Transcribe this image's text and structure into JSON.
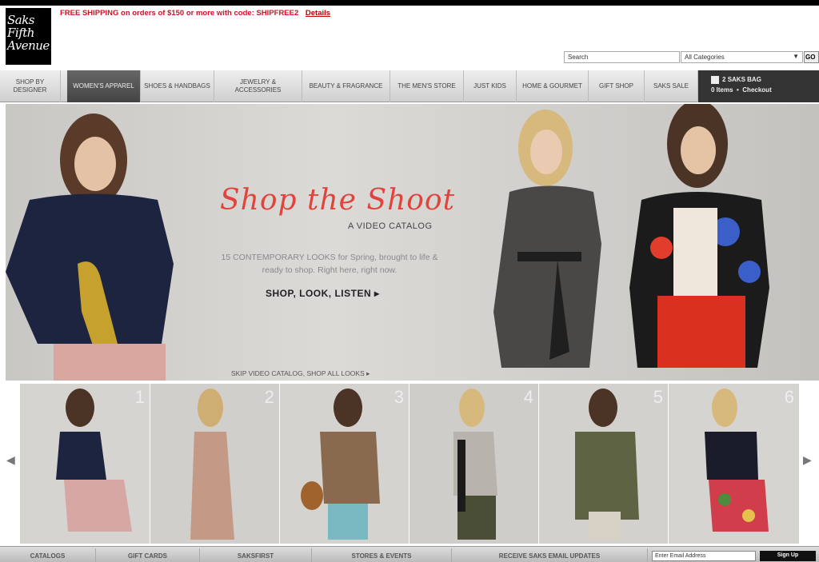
{
  "logo": {
    "line1": "Saks",
    "line2": "Fifth",
    "line3": "Avenue"
  },
  "promo": {
    "text": "FREE SHIPPING on orders of $150 or more with code: SHIPFREE2",
    "details": "Details"
  },
  "search": {
    "placeholder": "Search",
    "category": "All Categories",
    "go": "GO"
  },
  "nav": [
    {
      "label": "SHOP BY DESIGNER"
    },
    {
      "label": "WOMEN'S APPAREL"
    },
    {
      "label": "SHOES & HANDBAGS"
    },
    {
      "label": "JEWELRY & ACCESSORIES"
    },
    {
      "label": "BEAUTY & FRAGRANCE"
    },
    {
      "label": "THE MEN'S STORE"
    },
    {
      "label": "JUST KIDS"
    },
    {
      "label": "HOME & GOURMET"
    },
    {
      "label": "GIFT SHOP"
    },
    {
      "label": "SAKS SALE"
    }
  ],
  "bag": {
    "title": "SAKS BAG",
    "items": "0 Items",
    "checkout": "Checkout",
    "count": "2"
  },
  "hero": {
    "title": "Shop the Shoot",
    "subtitle": "A VIDEO CATALOG",
    "description": "15 CONTEMPORARY LOOKS for Spring, brought to life & ready to shop. Right here, right now.",
    "cta": "SHOP, LOOK, LISTEN ▸",
    "skip": "SKIP VIDEO CATALOG, SHOP ALL LOOKS ▸"
  },
  "thumbs": [
    {
      "num": "1"
    },
    {
      "num": "2"
    },
    {
      "num": "3"
    },
    {
      "num": "4"
    },
    {
      "num": "5"
    },
    {
      "num": "6"
    }
  ],
  "footer": {
    "links": [
      "CATALOGS",
      "GIFT CARDS",
      "SAKSFIRST",
      "STORES & EVENTS",
      "RECEIVE SAKS EMAIL UPDATES"
    ],
    "email_placeholder": "Enter Email Address",
    "signup": "Sign Up"
  },
  "colors": {
    "accent": "#d01229",
    "title": "#e0443c",
    "nav_active": "#555555"
  }
}
